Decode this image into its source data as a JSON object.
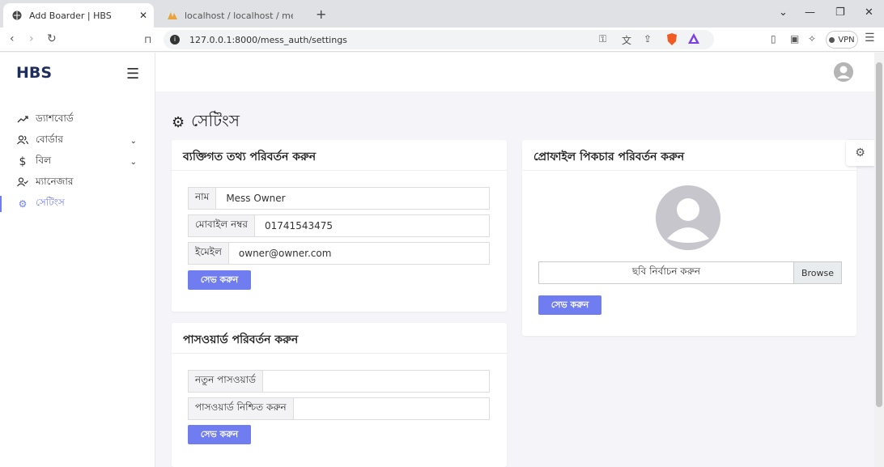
{
  "browser": {
    "tabs": [
      {
        "title": "Add Boarder | HBS"
      },
      {
        "title": "localhost / localhost / mess_manag"
      }
    ],
    "url": "127.0.0.1:8000/mess_auth/settings",
    "vpn_label": "VPN"
  },
  "sidebar": {
    "brand": "HBS",
    "items": [
      {
        "label": "ড্যাশবোর্ড",
        "icon": "trend-icon"
      },
      {
        "label": "বোর্ডার",
        "icon": "users-icon"
      },
      {
        "label": "বিল",
        "icon": "dollar-icon"
      },
      {
        "label": "ম্যানেজার",
        "icon": "user-check-icon"
      },
      {
        "label": "সেটিংস",
        "icon": "gear-icon"
      }
    ]
  },
  "page": {
    "title": "সেটিংস"
  },
  "personal_card": {
    "title": "ব্যক্তিগত তথ্য পরিবর্তন করুন",
    "fields": [
      {
        "label": "নাম",
        "value": "Mess Owner"
      },
      {
        "label": "মোবাইল নম্বর",
        "value": "01741543475"
      },
      {
        "label": "ইমেইল",
        "value": "owner@owner.com"
      }
    ],
    "save_label": "সেভ করুন"
  },
  "password_card": {
    "title": "পাসওয়ার্ড পরিবর্তন করুন",
    "fields": [
      {
        "label": "নতুন পাসওয়ার্ড",
        "value": ""
      },
      {
        "label": "পাসওয়ার্ড নিশ্চিত করুন",
        "value": ""
      }
    ],
    "save_label": "সেভ করুন"
  },
  "profile_card": {
    "title": "প্রোফাইল পিকচার পরিবর্তন করুন",
    "file_placeholder": "ছবি নির্বাচন করুন",
    "browse_label": "Browse",
    "save_label": "সেভ করুন"
  },
  "colors": {
    "accent": "#6f7df0",
    "brand": "#1f2d5c"
  }
}
